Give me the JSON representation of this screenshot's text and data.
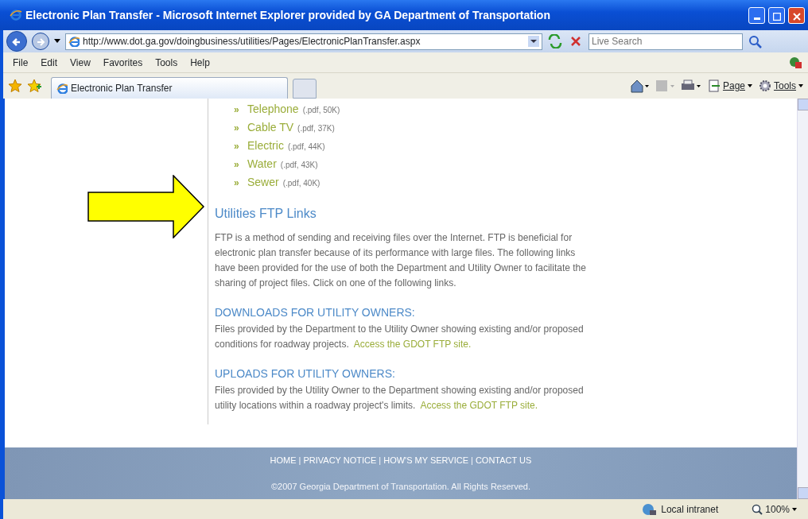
{
  "window": {
    "title": "Electronic Plan Transfer - Microsoft Internet Explorer provided by GA Department of Transportation"
  },
  "address_bar": {
    "url": "http://www.dot.ga.gov/doingbusiness/utilities/Pages/ElectronicPlanTransfer.aspx"
  },
  "search": {
    "placeholder": "Live Search"
  },
  "menu": [
    "File",
    "Edit",
    "View",
    "Favorites",
    "Tools",
    "Help"
  ],
  "tabs": [
    {
      "label": "Electronic Plan Transfer",
      "selected": true
    }
  ],
  "command_bar": [
    {
      "label": "Page"
    },
    {
      "label": "Tools"
    }
  ],
  "bullet": "»",
  "file_links": [
    {
      "name": "Telephone",
      "info": "(.pdf, 50K)"
    },
    {
      "name": "Cable TV",
      "info": "(.pdf, 37K)"
    },
    {
      "name": "Electric",
      "info": "(.pdf, 44K)"
    },
    {
      "name": "Water",
      "info": "(.pdf, 43K)"
    },
    {
      "name": "Sewer",
      "info": "(.pdf, 40K)"
    }
  ],
  "section": {
    "heading": "Utilities FTP Links",
    "intro": "FTP is a method of sending and receiving files over the Internet. FTP is beneficial for electronic plan transfer because of its performance with large files. The following links have been provided for the use of both the Department and Utility Owner to facilitate the sharing of project files. Click on one of the following links.",
    "groups": [
      {
        "heading": "DOWNLOADS FOR UTILITY OWNERS:",
        "text": "Files provided by the Department to the Utility Owner showing existing and/or proposed conditions for roadway projects.",
        "link": "Access the GDOT FTP site."
      },
      {
        "heading": "UPLOADS FOR UTILITY OWNERS:",
        "text": "Files provided by the Utility Owner to the Department showing existing and/or proposed utility locations within a roadway project's limits.",
        "link": "Access the GDOT FTP site."
      }
    ]
  },
  "footer": {
    "links": [
      "HOME",
      "PRIVACY NOTICE",
      "HOW'S MY SERVICE",
      "CONTACT US"
    ],
    "separator": "|",
    "copyright": "©2007 Georgia Department of Transportation. All Rights Reserved."
  },
  "status_bar": {
    "zone": "Local intranet",
    "zoom": "100%"
  }
}
